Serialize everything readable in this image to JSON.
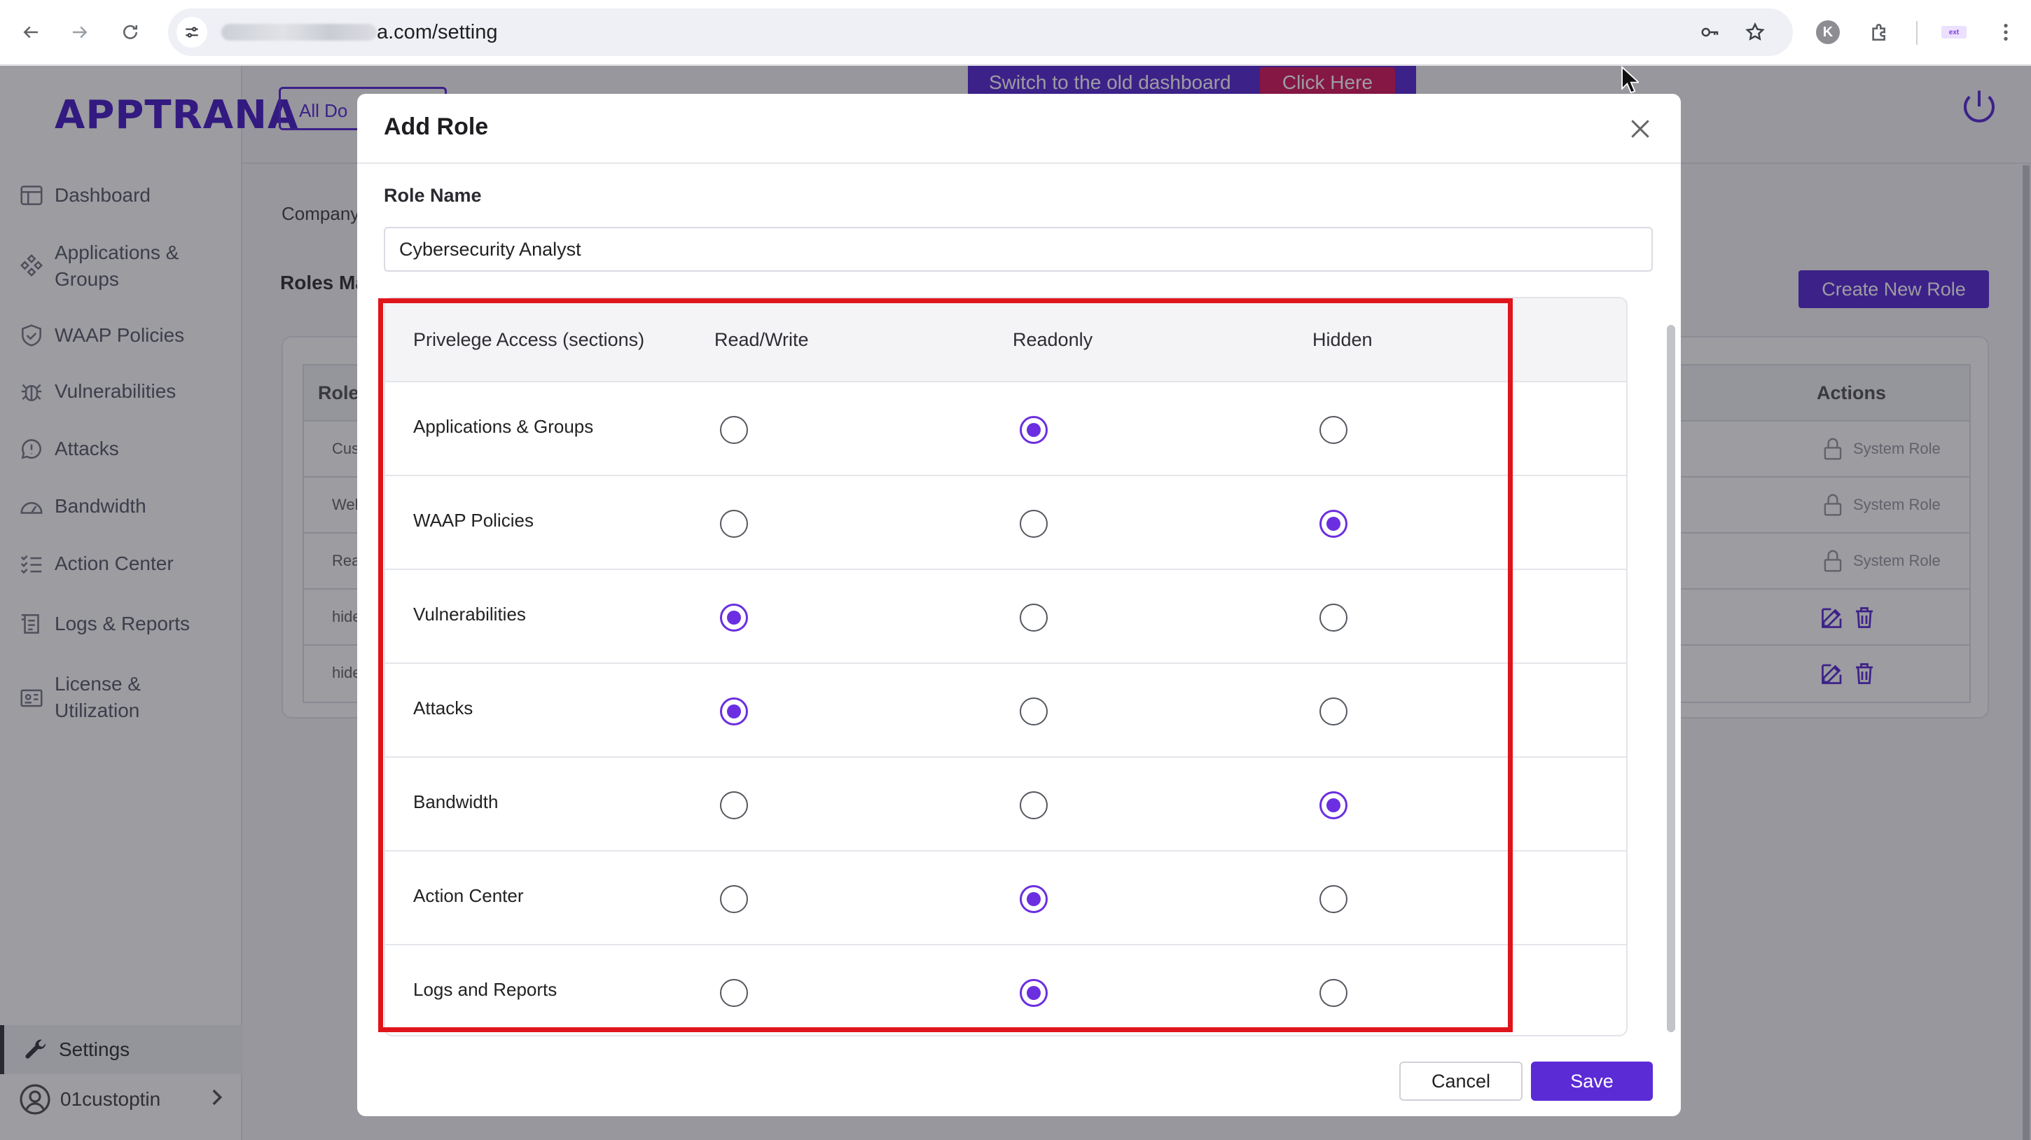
{
  "browser": {
    "url_visible": "a.com/setting",
    "profile_initial": "K",
    "extension_badge": "ext"
  },
  "page": {
    "logo": "APPTRANA",
    "domain_selector": "All Do",
    "banner": {
      "text": "Switch to the old dashboard",
      "button": "Click Here"
    },
    "company_tab": "Company",
    "roles_title": "Roles Ma",
    "create_role_button": "Create New Role",
    "roles_table": {
      "col_role": "Role",
      "col_actions": "Actions",
      "rows": [
        {
          "name": "Cus",
          "action": "System Role"
        },
        {
          "name": "Web",
          "action": "System Role"
        },
        {
          "name": "Rea",
          "action": "System Role"
        },
        {
          "name": "hide",
          "action": ""
        },
        {
          "name": "hide",
          "action": ""
        }
      ]
    }
  },
  "sidebar": {
    "items": [
      {
        "label": "Dashboard"
      },
      {
        "label": "Applications &\nGroups"
      },
      {
        "label": "WAAP Policies"
      },
      {
        "label": "Vulnerabilities"
      },
      {
        "label": "Attacks"
      },
      {
        "label": "Bandwidth"
      },
      {
        "label": "Action Center"
      },
      {
        "label": "Logs & Reports"
      },
      {
        "label": "License &\nUtilization"
      }
    ],
    "settings": "Settings",
    "user": "01custoptin"
  },
  "modal": {
    "title": "Add Role",
    "role_name_label": "Role Name",
    "role_name_value": "Cybersecurity Analyst",
    "table": {
      "headers": [
        "Privelege Access (sections)",
        "Read/Write",
        "Readonly",
        "Hidden"
      ],
      "rows": [
        {
          "section": "Applications & Groups",
          "selected": "Readonly"
        },
        {
          "section": "WAAP Policies",
          "selected": "Hidden"
        },
        {
          "section": "Vulnerabilities",
          "selected": "Read/Write"
        },
        {
          "section": "Attacks",
          "selected": "Read/Write"
        },
        {
          "section": "Bandwidth",
          "selected": "Hidden"
        },
        {
          "section": "Action Center",
          "selected": "Readonly"
        },
        {
          "section": "Logs and Reports",
          "selected": "Readonly"
        }
      ]
    },
    "cancel": "Cancel",
    "save": "Save"
  },
  "colors": {
    "accent": "#5b2bd6",
    "radio_checked": "#6b2ee0",
    "highlight_box": "#e0151b",
    "banner_button": "#d81b60"
  }
}
